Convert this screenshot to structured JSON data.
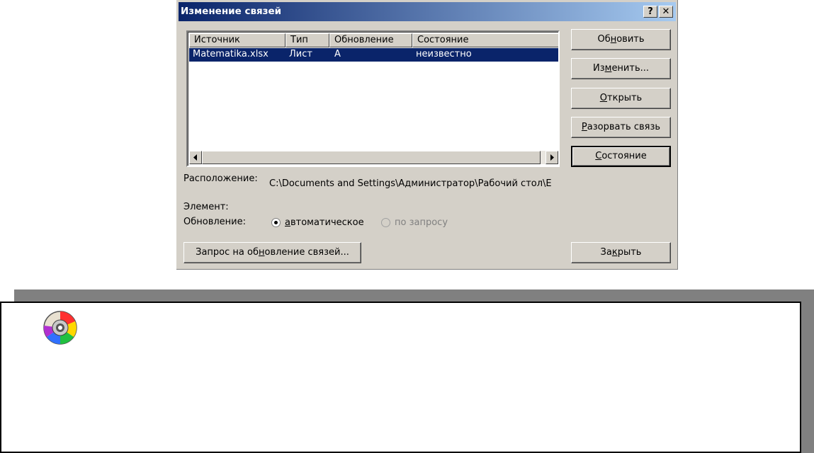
{
  "dialog": {
    "title": "Изменение связей",
    "help_button": "?",
    "close_button": "✕",
    "table": {
      "columns": [
        "Источник",
        "Тип",
        "Обновление",
        "Состояние"
      ],
      "rows": [
        {
          "source": "Matematika.xlsx",
          "type": "Лист",
          "update": "А",
          "status": "неизвестно"
        }
      ]
    },
    "buttons": {
      "refresh": {
        "pre": "Об",
        "acc": "н",
        "post": "овить"
      },
      "change": {
        "pre": "Из",
        "acc": "м",
        "post": "енить..."
      },
      "open": {
        "pre": "",
        "acc": "О",
        "post": "ткрыть"
      },
      "break_link": {
        "pre": "",
        "acc": "Р",
        "post": "азорвать связь"
      },
      "status": {
        "pre": "",
        "acc": "С",
        "post": "остояние"
      },
      "request": {
        "pre": "Запрос на об",
        "acc": "н",
        "post": "овление связей..."
      },
      "close": {
        "pre": "За",
        "acc": "к",
        "post": "рыть"
      }
    },
    "location_label": "Расположение:",
    "location_value": "C:\\Documents and Settings\\Администратор\\Рабочий стол\\Е",
    "element_label": "Элемент:",
    "update_label": "Обновление:",
    "update_options": {
      "automatic": {
        "acc": "а",
        "post": "втоматическое",
        "selected": true
      },
      "manual": {
        "label": "по запросу",
        "selected": false,
        "disabled": true
      }
    }
  },
  "icons": {
    "cd": "cd-disc-icon"
  }
}
